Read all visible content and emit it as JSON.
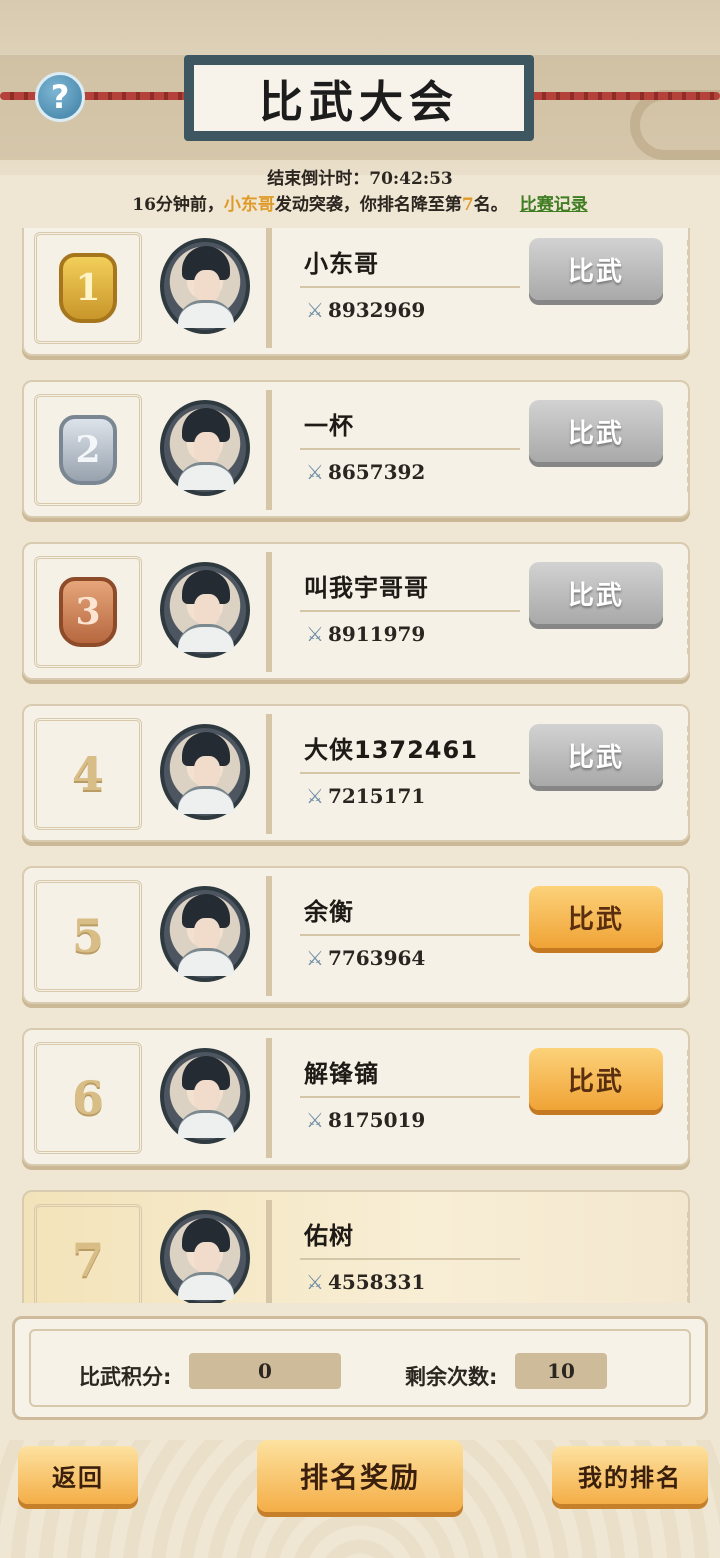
{
  "header": {
    "title": "比武大会",
    "help_glyph": "?",
    "countdown_label": "结束倒计时：",
    "countdown_value": "70:42:53",
    "notice_prefix": "16分钟前，",
    "notice_attacker": "小东哥",
    "notice_middle": "发动突袭，你排名降至第",
    "notice_rank": "7",
    "notice_suffix": "名。",
    "record_link": "比赛记录"
  },
  "players": [
    {
      "rank": "1",
      "name": "小东哥",
      "power": "8932969",
      "button": "比武",
      "button_state": "gray"
    },
    {
      "rank": "2",
      "name": "一杯",
      "power": "8657392",
      "button": "比武",
      "button_state": "gray"
    },
    {
      "rank": "3",
      "name": "叫我宇哥哥",
      "power": "8911979",
      "button": "比武",
      "button_state": "gray"
    },
    {
      "rank": "4",
      "name": "大侠1372461",
      "power": "7215171",
      "button": "比武",
      "button_state": "gray"
    },
    {
      "rank": "5",
      "name": "余衡",
      "power": "7763964",
      "button": "比武",
      "button_state": "orange"
    },
    {
      "rank": "6",
      "name": "解锋镝",
      "power": "8175019",
      "button": "比武",
      "button_state": "orange"
    },
    {
      "rank": "7",
      "name": "佑树",
      "power": "4558331",
      "button": "",
      "button_state": "self"
    }
  ],
  "stats": {
    "points_label": "比武积分:",
    "points_value": "0",
    "remaining_label": "剩余次数:",
    "remaining_value": "10"
  },
  "bottom": {
    "back": "返回",
    "rewards": "排名奖励",
    "my_rank": "我的排名"
  },
  "icons": {
    "power": "sword-icon",
    "help": "help-icon"
  },
  "colors": {
    "highlight": "#e09a28",
    "link": "#3f7d22",
    "button_orange": "#f0a336",
    "button_gray": "#a9a9a9"
  }
}
